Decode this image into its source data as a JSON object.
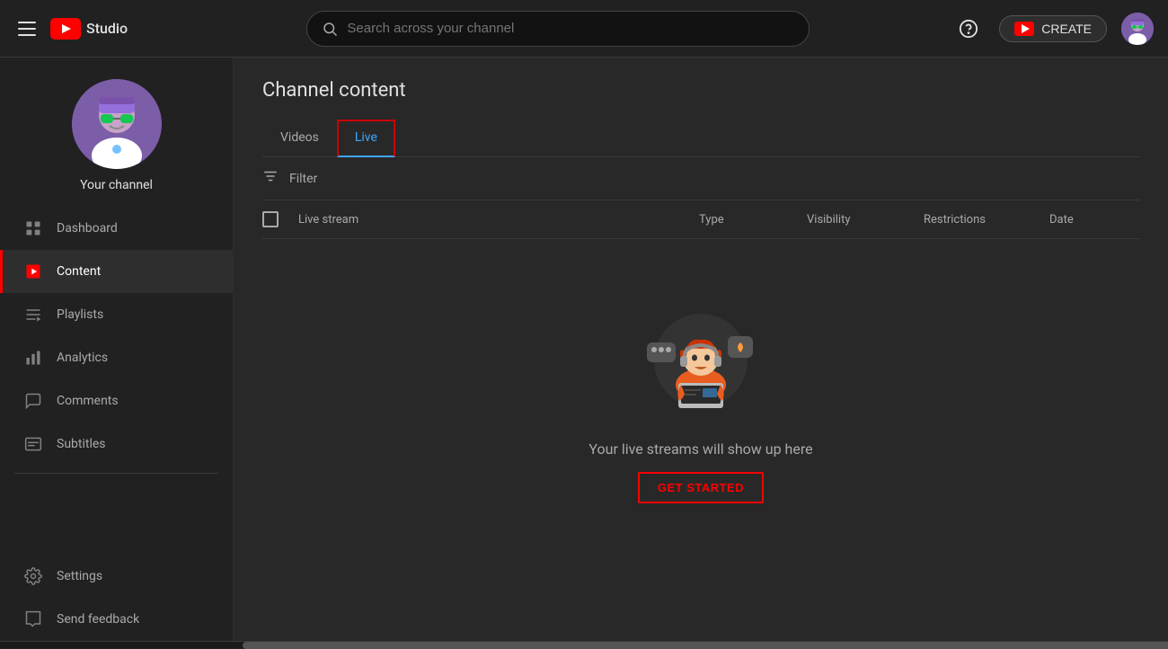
{
  "header": {
    "menu_icon": "hamburger-icon",
    "logo_text": "Studio",
    "search_placeholder": "Search across your channel",
    "help_icon": "?",
    "create_label": "CREATE",
    "avatar_alt": "user-avatar"
  },
  "sidebar": {
    "channel_name": "Your channel",
    "nav_items": [
      {
        "id": "dashboard",
        "label": "Dashboard",
        "icon": "dashboard-icon"
      },
      {
        "id": "content",
        "label": "Content",
        "icon": "content-icon",
        "active": true
      },
      {
        "id": "playlists",
        "label": "Playlists",
        "icon": "playlists-icon"
      },
      {
        "id": "analytics",
        "label": "Analytics",
        "icon": "analytics-icon"
      },
      {
        "id": "comments",
        "label": "Comments",
        "icon": "comments-icon"
      },
      {
        "id": "subtitles",
        "label": "Subtitles",
        "icon": "subtitles-icon"
      }
    ],
    "bottom_items": [
      {
        "id": "settings",
        "label": "Settings",
        "icon": "settings-icon"
      },
      {
        "id": "feedback",
        "label": "Send feedback",
        "icon": "feedback-icon"
      }
    ]
  },
  "main": {
    "page_title": "Channel content",
    "tabs": [
      {
        "id": "videos",
        "label": "Videos",
        "active": false
      },
      {
        "id": "live",
        "label": "Live",
        "active": true
      }
    ],
    "filter_placeholder": "Filter",
    "table": {
      "columns": [
        {
          "id": "stream",
          "label": "Live stream"
        },
        {
          "id": "type",
          "label": "Type"
        },
        {
          "id": "visibility",
          "label": "Visibility"
        },
        {
          "id": "restrictions",
          "label": "Restrictions"
        },
        {
          "id": "date",
          "label": "Date"
        }
      ]
    },
    "empty_state": {
      "text": "Your live streams will show up here",
      "cta_label": "GET STARTED"
    }
  }
}
